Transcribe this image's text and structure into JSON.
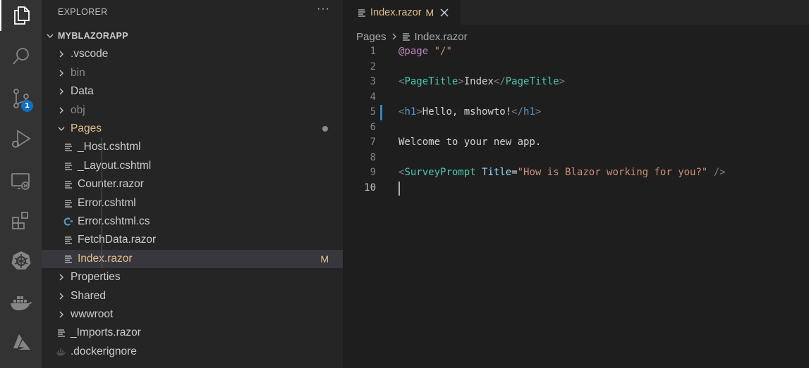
{
  "sidebar": {
    "title": "EXPLORER",
    "more": "···",
    "root": "MYBLAZORAPP",
    "items": [
      {
        "label": ".vscode",
        "type": "folder"
      },
      {
        "label": "bin",
        "type": "folder",
        "dim": true
      },
      {
        "label": "Data",
        "type": "folder"
      },
      {
        "label": "obj",
        "type": "folder",
        "dim": true
      },
      {
        "label": "Pages",
        "type": "folder-open",
        "modified": true
      },
      {
        "label": "_Host.cshtml",
        "type": "file"
      },
      {
        "label": "_Layout.cshtml",
        "type": "file"
      },
      {
        "label": "Counter.razor",
        "type": "file"
      },
      {
        "label": "Error.cshtml",
        "type": "file"
      },
      {
        "label": "Error.cshtml.cs",
        "type": "csharp"
      },
      {
        "label": "FetchData.razor",
        "type": "file"
      },
      {
        "label": "Index.razor",
        "type": "file",
        "selected": true,
        "decoration": "M"
      },
      {
        "label": "Properties",
        "type": "folder"
      },
      {
        "label": "Shared",
        "type": "folder"
      },
      {
        "label": "wwwroot",
        "type": "folder"
      },
      {
        "label": "_Imports.razor",
        "type": "file"
      },
      {
        "label": ".dockerignore",
        "type": "docker"
      }
    ]
  },
  "activity": {
    "badge": "1",
    "icons": [
      "explorer-icon",
      "search-icon",
      "source-control-icon",
      "run-debug-icon",
      "remote-explorer-icon",
      "extensions-icon",
      "kubernetes-icon",
      "docker-icon",
      "azure-icon"
    ]
  },
  "editor": {
    "tab": {
      "label": "Index.razor",
      "decoration": "M"
    },
    "breadcrumb": {
      "folder": "Pages",
      "file": "Index.razor"
    },
    "lines": [
      {
        "n": "1",
        "tokens": [
          [
            "c-dir",
            "@page"
          ],
          [
            "c-text",
            " "
          ],
          [
            "c-str",
            "\"/\""
          ]
        ]
      },
      {
        "n": "2",
        "tokens": []
      },
      {
        "n": "3",
        "tokens": [
          [
            "c-punct",
            "<"
          ],
          [
            "c-tag",
            "PageTitle"
          ],
          [
            "c-punct",
            ">"
          ],
          [
            "c-text",
            "Index"
          ],
          [
            "c-punct",
            "</"
          ],
          [
            "c-tag",
            "PageTitle"
          ],
          [
            "c-punct",
            ">"
          ]
        ]
      },
      {
        "n": "4",
        "tokens": []
      },
      {
        "n": "5",
        "tokens": [
          [
            "c-punct",
            "<"
          ],
          [
            "c-htag",
            "h1"
          ],
          [
            "c-punct",
            ">"
          ],
          [
            "c-text",
            "Hello, mshowto!"
          ],
          [
            "c-punct",
            "</"
          ],
          [
            "c-htag",
            "h1"
          ],
          [
            "c-punct",
            ">"
          ]
        ],
        "modified": true
      },
      {
        "n": "6",
        "tokens": []
      },
      {
        "n": "7",
        "tokens": [
          [
            "c-text",
            "Welcome to your new app."
          ]
        ]
      },
      {
        "n": "8",
        "tokens": []
      },
      {
        "n": "9",
        "tokens": [
          [
            "c-punct",
            "<"
          ],
          [
            "c-tag",
            "SurveyPrompt"
          ],
          [
            "c-text",
            " "
          ],
          [
            "c-attr",
            "Title"
          ],
          [
            "c-text",
            "="
          ],
          [
            "c-str",
            "\"How is Blazor working for you?\""
          ],
          [
            "c-text",
            " "
          ],
          [
            "c-punct",
            "/>"
          ]
        ]
      },
      {
        "n": "10",
        "tokens": [],
        "current": true
      }
    ]
  },
  "colors": {
    "activity_bg": "#333333",
    "sidebar_bg": "#252526",
    "editor_bg": "#1e1e1e",
    "modified": "#e2c08d",
    "badge": "#0e70c0"
  }
}
